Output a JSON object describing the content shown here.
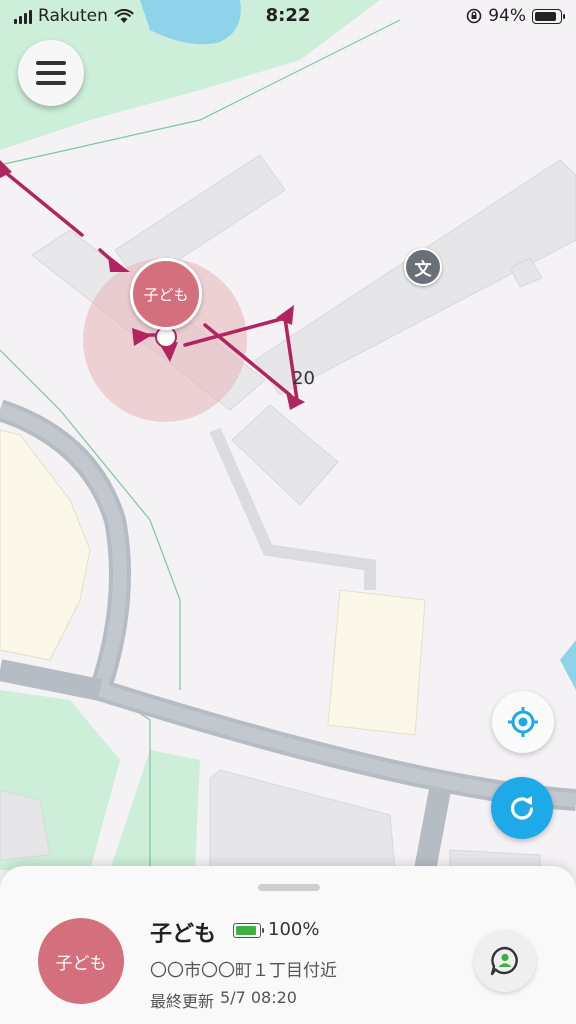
{
  "status_bar": {
    "carrier": "Rakuten",
    "time": "8:22",
    "battery_percent": "94%",
    "battery_level": 0.94
  },
  "map": {
    "number_label": "20",
    "school_symbol": "文",
    "child_label": "子ども",
    "colors": {
      "route": "#b0245f",
      "accuracy_circle": "#e8b4ba",
      "road": "#b6bcc4",
      "building": "#e6e6e8",
      "highlight_building": "#fbf8ea",
      "park": "#cdeed9",
      "water": "#8fd3ea"
    }
  },
  "controls": {
    "menu_icon": "hamburger-icon",
    "locate_icon": "crosshair-icon",
    "refresh_icon": "refresh-icon"
  },
  "sheet": {
    "avatar_label": "子ども",
    "name": "子ども",
    "battery_percent": "100%",
    "battery_level": 1.0,
    "address": "〇〇市〇〇町１丁目付近",
    "updated_label": "最終更新",
    "updated_value": "5/7 08:20",
    "chat_icon": "chat-person-icon"
  }
}
